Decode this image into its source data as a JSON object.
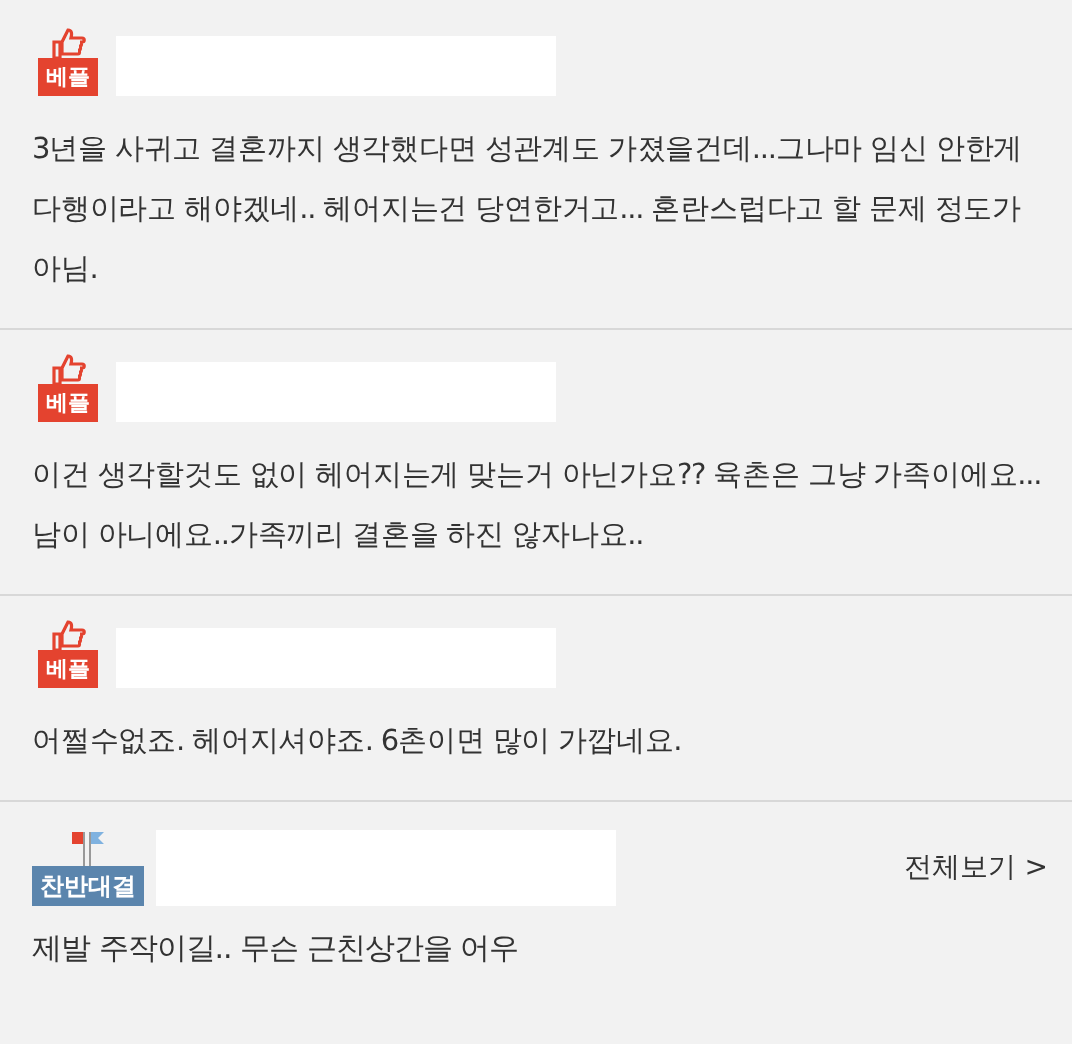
{
  "comments": [
    {
      "badge": "베플",
      "text": "3년을 사귀고 결혼까지 생각했다면 성관계도 가졌을건데...그나마 임신 안한게 다행이라고 해야겠네.. 헤어지는건 당연한거고... 혼란스럽다고 할 문제 정도가 아님."
    },
    {
      "badge": "베플",
      "text": "이건 생각할것도 없이 헤어지는게 맞는거 아닌가요?? 육촌은 그냥 가족이에요...남이 아니에요..가족끼리 결혼을 하진 않자나요.."
    },
    {
      "badge": "베플",
      "text": "어쩔수없죠. 헤어지셔야죠. 6촌이면 많이 가깝네요."
    }
  ],
  "debate": {
    "badge": "찬반대결",
    "link": "전체보기 >",
    "text": "제발 주작이길.. 무슨 근친상간을 어우"
  }
}
